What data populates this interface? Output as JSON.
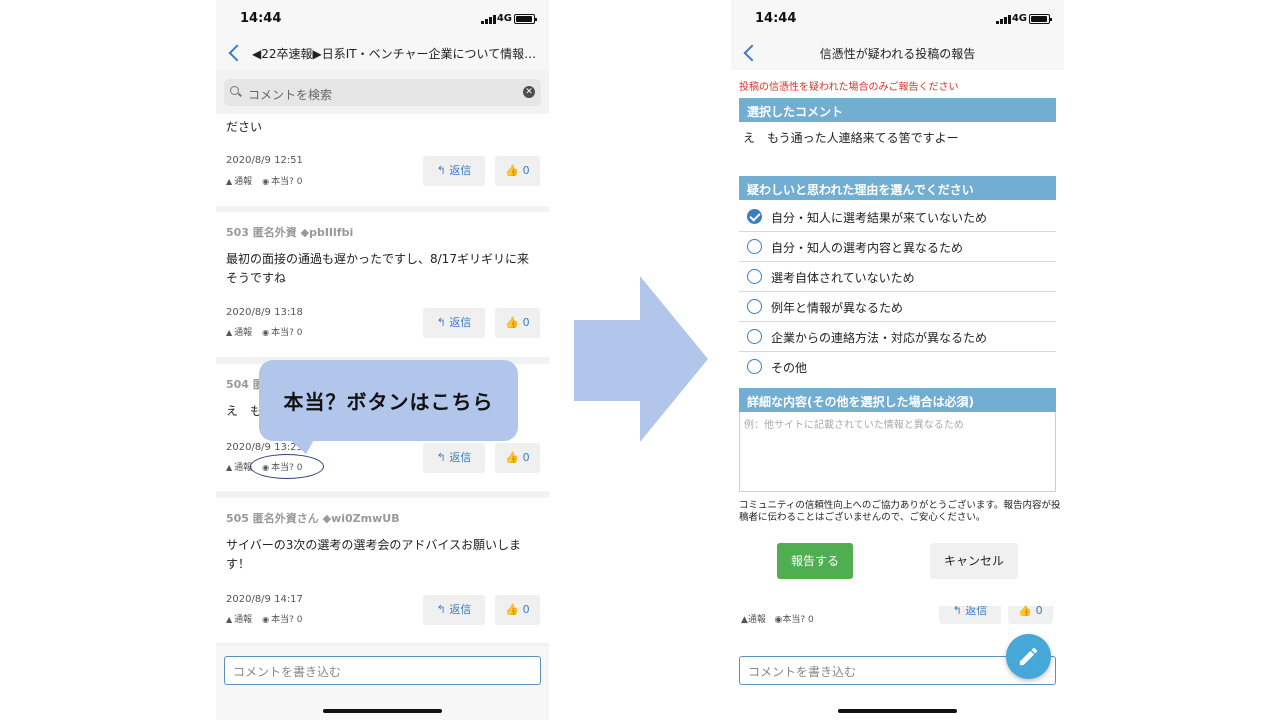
{
  "status": {
    "time": "14:44",
    "network": "4G"
  },
  "left": {
    "nav_title": "◀22卒速報▶日系IT・ベンチャー企業について情報…",
    "search_placeholder": "コメントを検索",
    "compose_placeholder": "コメントを書き込む",
    "cards": [
      {
        "head": "",
        "body": "ださい",
        "date": "2020/8/9 12:51",
        "report": "通報",
        "honto": "本当? 0",
        "reply": "返信",
        "likes": "0"
      },
      {
        "head": "503 匿名外資 ◆pbIIlfbi",
        "body": "最初の面接の通過も遅かったですし、8/17ギリギリに来そうですね",
        "date": "2020/8/9 13:18",
        "report": "通報",
        "honto": "本当? 0",
        "reply": "返信",
        "likes": "0"
      },
      {
        "head": "504 匿",
        "body": "え　も",
        "date": "2020/8/9 13:25",
        "report": "通報",
        "honto": "本当? 0",
        "reply": "返信",
        "likes": "0"
      },
      {
        "head": "505 匿名外資さん ◆wi0ZmwUB",
        "body": "サイバーの3次の選考の選考会のアドバイスお願いします！",
        "date": "2020/8/9 14:17",
        "report": "通報",
        "honto": "本当? 0",
        "reply": "返信",
        "likes": "0"
      }
    ]
  },
  "callout": {
    "text": "本当？ボタンはこちら"
  },
  "right": {
    "nav_title": "信憑性が疑われる投稿の報告",
    "warning": "投稿の信憑性を疑われた場合のみご報告ください",
    "selected_header": "選択したコメント",
    "selected_text": "え　もう通った人連絡来てる筈ですよー",
    "reasons_header": "疑わしいと思われた理由を選んでください",
    "options": [
      {
        "label": "自分・知人に選考結果が来ていないため",
        "checked": true
      },
      {
        "label": "自分・知人の選考内容と異なるため",
        "checked": false
      },
      {
        "label": "選考自体されていないため",
        "checked": false
      },
      {
        "label": "例年と情報が異なるため",
        "checked": false
      },
      {
        "label": "企業からの連絡方法・対応が異なるため",
        "checked": false
      },
      {
        "label": "その他",
        "checked": false
      }
    ],
    "detail_header": "詳細な内容(その他を選択した場合は必須)",
    "detail_placeholder": "例：他サイトに記載されていた情報と異なるため",
    "notice": "コミュニティの信頼性向上へのご協力ありがとうございます。報告内容が投稿者に伝わることはございませんので、ご安心ください。",
    "report_button": "報告する",
    "cancel_button": "キャンセル",
    "peek": {
      "report": "通報",
      "honto": "本当? 0",
      "reply": "返信",
      "likes": "0"
    },
    "compose_placeholder": "コメントを書き込む"
  },
  "colors": {
    "accent_blue": "#3a7dc4",
    "section_header": "#72aed1",
    "report_green": "#4fae4f",
    "callout": "#b1c6ea",
    "warning_red": "#d9342b"
  }
}
